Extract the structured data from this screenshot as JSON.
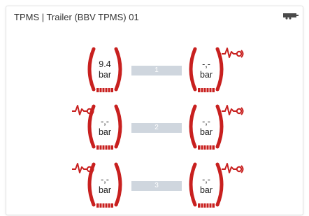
{
  "widget": {
    "title": "TPMS | Trailer (BBV TPMS) 01",
    "header_icon": "trailer-icon"
  },
  "colors": {
    "tire": "#c8201f",
    "connector": "#cfd6de",
    "connector_text": "#ffffff",
    "title_text": "#333333"
  },
  "axles": [
    {
      "label": "1",
      "left": {
        "value": "9.4",
        "unit": "bar",
        "alert": false
      },
      "right": {
        "value": "-,-",
        "unit": "bar",
        "alert": true
      }
    },
    {
      "label": "2",
      "left": {
        "value": "-,-",
        "unit": "bar",
        "alert": true
      },
      "right": {
        "value": "-,-",
        "unit": "bar",
        "alert": true
      }
    },
    {
      "label": "3",
      "left": {
        "value": "-,-",
        "unit": "bar",
        "alert": true
      },
      "right": {
        "value": "-,-",
        "unit": "bar",
        "alert": true
      }
    }
  ]
}
